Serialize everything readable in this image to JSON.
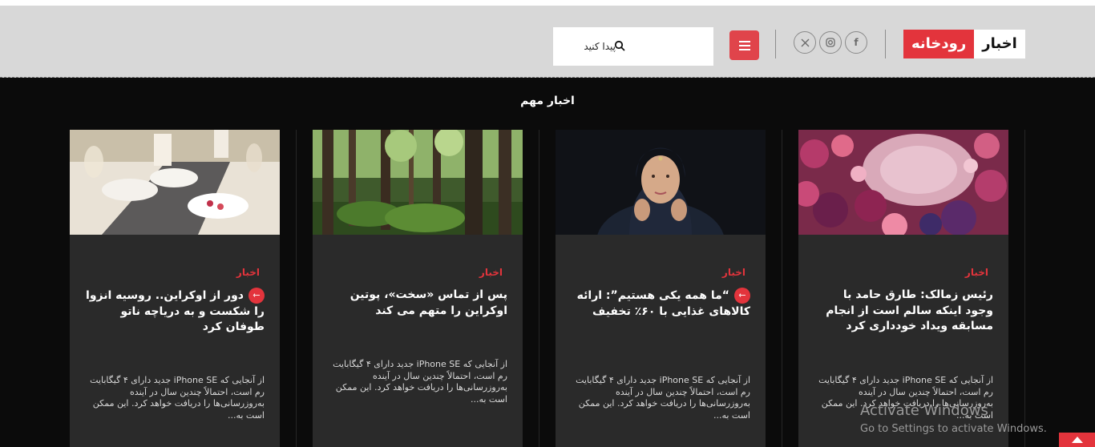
{
  "header": {
    "logo_red": "رودخانه",
    "logo_white": "اخبار",
    "search_placeholder": "پیدا کنید",
    "social": [
      {
        "icon": "facebook-icon",
        "glyph": "f"
      },
      {
        "icon": "instagram-icon",
        "glyph": "◎"
      },
      {
        "icon": "x-twitter-icon",
        "glyph": "𝕏"
      }
    ]
  },
  "section": {
    "title": "اخبار مهم"
  },
  "cards": [
    {
      "category": "اخبار",
      "title": "رئیس زمالک: طارق حامد با وجود اینکه سالم است از انجام مسابقه ویداد خودداری کرد",
      "has_icon": false,
      "excerpt": "از آنجایی که iPhone SE جدید دارای ۴ گیگابایت رم است، احتمالاً چندین سال در آینده به‌روزرسانی‌ها را دریافت خواهد کرد. این ممکن است به..."
    },
    {
      "category": "اخبار",
      "title": "“ما همه یکی هستیم”: ارائه کالاهای غذایی با ۶۰٪ تخفیف",
      "has_icon": true,
      "excerpt": "از آنجایی که iPhone SE جدید دارای ۴ گیگابایت رم است، احتمالاً چندین سال در آینده به‌روزرسانی‌ها را دریافت خواهد کرد. این ممکن است به..."
    },
    {
      "category": "اخبار",
      "title": "پس از تماس «سخت»، پوتین اوکراین را متهم می کند",
      "has_icon": false,
      "excerpt": "از آنجایی که iPhone SE جدید دارای ۴ گیگابایت رم است، احتمالاً چندین سال در آینده به‌روزرسانی‌ها را دریافت خواهد کرد. این ممکن است به..."
    },
    {
      "category": "اخبار",
      "title": "دور از اوکراین.. روسیه انزوا را شکست و به دریاچه ناتو طوفان کرد",
      "has_icon": true,
      "excerpt": "از آنجایی که iPhone SE جدید دارای ۴ گیگابایت رم است، احتمالاً چندین سال در آینده به‌روزرسانی‌ها را دریافت خواهد کرد. این ممکن است به..."
    }
  ],
  "watermark": {
    "line1": "Activate Windows",
    "line2": "Go to Settings to activate Windows."
  },
  "colors": {
    "accent": "#e3343c",
    "card_bg": "#2a2a2a",
    "page_bg": "#0b0b0b",
    "header_bg": "#d8d8d8"
  }
}
